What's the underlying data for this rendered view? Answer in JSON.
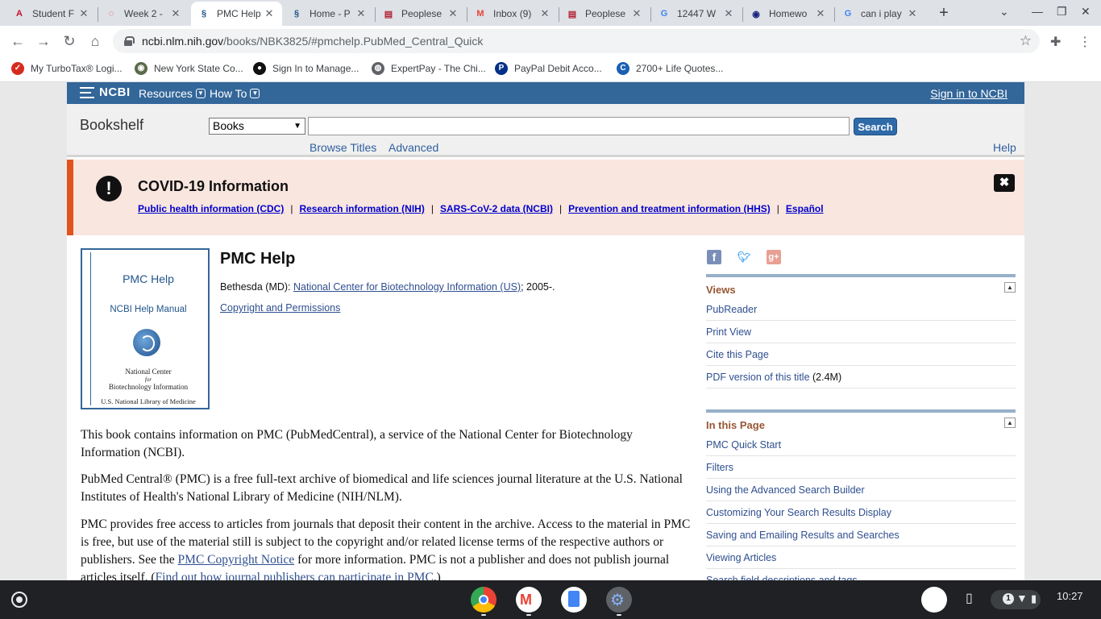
{
  "browser": {
    "tabs": [
      {
        "title": "Student F",
        "icon_name": "student-portal-icon",
        "active": false
      },
      {
        "title": "Week 2 -",
        "icon_name": "course-icon",
        "active": false
      },
      {
        "title": "PMC Help",
        "icon_name": "ncbi-icon",
        "active": true
      },
      {
        "title": "Home - P",
        "icon_name": "ncbi-icon",
        "active": false
      },
      {
        "title": "Peoplese",
        "icon_name": "flag-icon",
        "active": false
      },
      {
        "title": "Inbox (9)",
        "icon_name": "gmail-icon",
        "active": false
      },
      {
        "title": "Peoplese",
        "icon_name": "flag-icon",
        "active": false
      },
      {
        "title": "12447 W",
        "icon_name": "google-icon",
        "active": false
      },
      {
        "title": "Homewo",
        "icon_name": "homework-icon",
        "active": false
      },
      {
        "title": "can i play",
        "icon_name": "google-icon",
        "active": false
      }
    ],
    "close_glyph": "✕",
    "new_tab_glyph": "+",
    "url_host": "ncbi.nlm.nih.gov",
    "url_path": "/books/NBK3825/#pmchelp.PubMed_Central_Quick",
    "bookmarks": [
      {
        "label": "My TurboTax® Logi...",
        "icon_name": "turbotax-icon",
        "color": "#d52b1e"
      },
      {
        "label": "New York State Co...",
        "icon_name": "nys-seal-icon",
        "color": "#5b6b4a"
      },
      {
        "label": "Sign In to Manage...",
        "icon_name": "account-icon",
        "color": "#111111"
      },
      {
        "label": "ExpertPay - The Chi...",
        "icon_name": "globe-icon",
        "color": "#5f6368"
      },
      {
        "label": "PayPal Debit Acco...",
        "icon_name": "paypal-icon",
        "color": "#003087"
      },
      {
        "label": "2700+ Life Quotes...",
        "icon_name": "quotes-icon",
        "color": "#1a5fb4"
      }
    ]
  },
  "ncbi": {
    "logo_text": "NCBI",
    "resources_label": "Resources",
    "howto_label": "How To",
    "signin_label": "Sign in to NCBI",
    "bookshelf_label": "Bookshelf",
    "db_selected": "Books",
    "search_placeholder": "",
    "search_button": "Search",
    "browse_titles": "Browse Titles",
    "advanced": "Advanced",
    "help": "Help"
  },
  "covid": {
    "title": "COVID-19 Information",
    "links": [
      "Public health information (CDC)",
      "Research information (NIH)",
      "SARS-CoV-2 data (NCBI)",
      "Prevention and treatment information (HHS)",
      "Español"
    ],
    "separator": "|"
  },
  "book": {
    "cover_title": "PMC Help",
    "cover_subtitle": "NCBI Help Manual",
    "cover_org_line1": "National Center",
    "cover_org_line2": "for",
    "cover_org_line3": "Biotechnology Information",
    "cover_library": "U.S. National Library of Medicine",
    "title": "PMC Help",
    "pub_prefix": "Bethesda (MD): ",
    "pub_link": "National Center for Biotechnology Information (US)",
    "pub_suffix": "; 2005-.",
    "copyright_link": "Copyright and Permissions"
  },
  "content": {
    "p1": "This book contains information on PMC (PubMedCentral), a service of the National Center for Biotechnology Information (NCBI).",
    "p2": "PubMed Central® (PMC) is a free full-text archive of biomedical and life sciences journal literature at the U.S. National Institutes of Health's National Library of Medicine (NIH/NLM).",
    "p3_a": "PMC provides free access to articles from journals that deposit their content in the archive. Access to the material in PMC is free, but use of the material still is subject to the copyright and/or related license terms of the respective authors or publishers. See the ",
    "p3_link1": "PMC Copyright Notice",
    "p3_b": " for more information. PMC is not a publisher and does not publish journal articles itself. (",
    "p3_link2": "Find out how journal publishers can participate in PMC",
    "p3_c": ".)"
  },
  "sidebar": {
    "views_title": "Views",
    "views": [
      {
        "label": "PubReader",
        "extra": ""
      },
      {
        "label": "Print View",
        "extra": ""
      },
      {
        "label": "Cite this Page",
        "extra": ""
      },
      {
        "label": "PDF version of this title",
        "extra": " (2.4M)"
      }
    ],
    "inpage_title": "In this Page",
    "inpage": [
      "PMC Quick Start",
      "Filters",
      "Using the Advanced Search Builder",
      "Customizing Your Search Results Display",
      "Saving and Emailing Results and Searches",
      "Viewing Articles",
      "Search field descriptions and tags"
    ]
  },
  "shelf": {
    "notification_count": "1",
    "time": "10:27"
  }
}
